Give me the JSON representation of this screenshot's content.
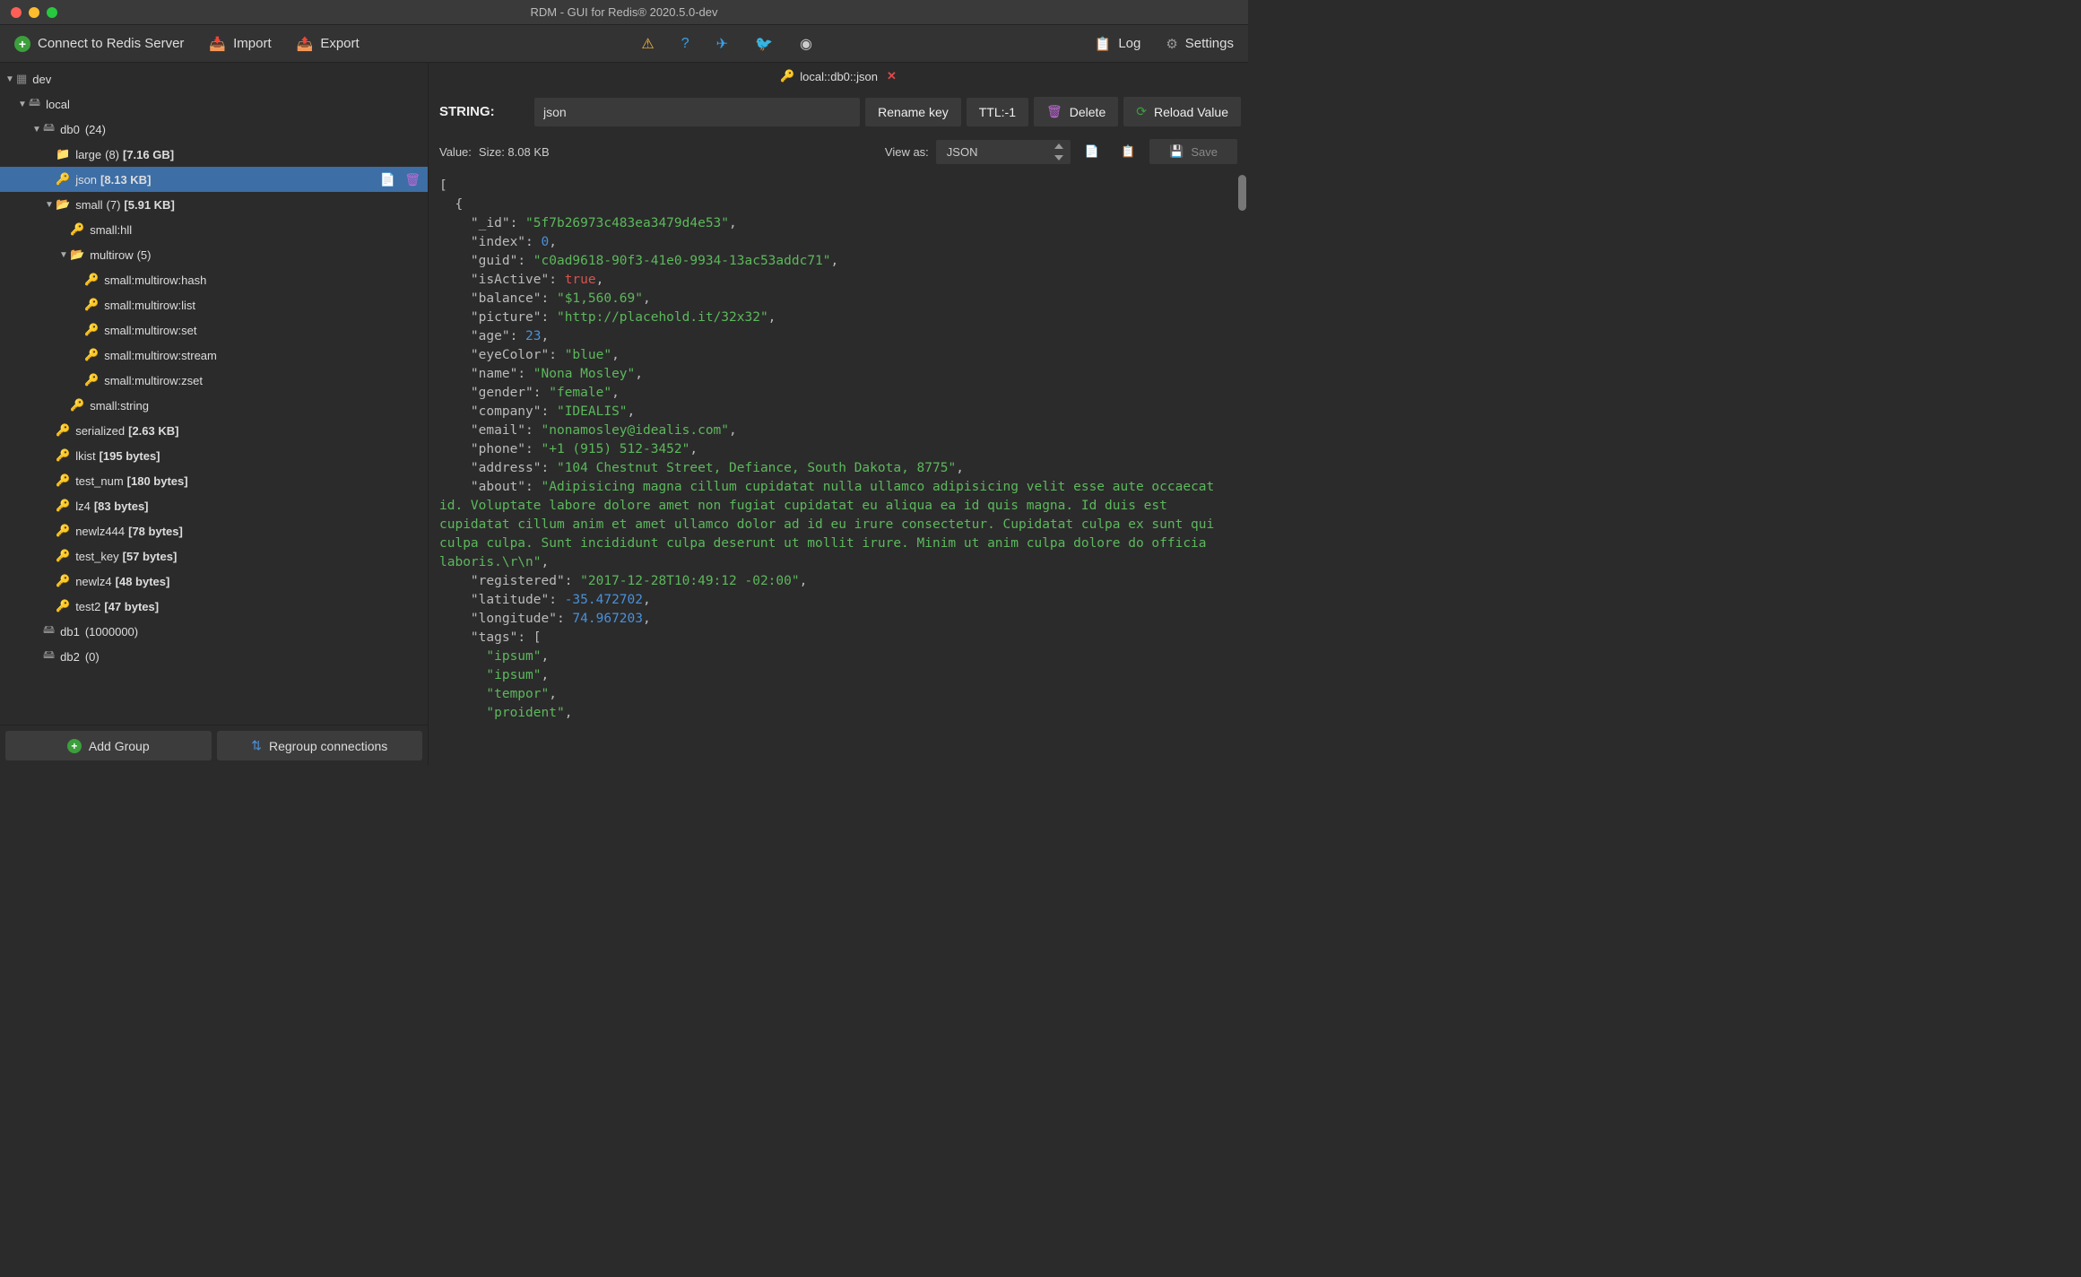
{
  "window": {
    "title": "RDM - GUI for Redis® 2020.5.0-dev"
  },
  "toolbar": {
    "connect": "Connect to Redis Server",
    "import": "Import",
    "export": "Export",
    "log": "Log",
    "settings": "Settings"
  },
  "tree": {
    "root": "dev",
    "server": "local",
    "db0": {
      "label": "db0",
      "count": "(24)"
    },
    "large": {
      "label": "large",
      "count": "(8)",
      "size": "[7.16 GB]"
    },
    "json": {
      "label": "json",
      "size": "[8.13 KB]"
    },
    "small": {
      "label": "small",
      "count": "(7)",
      "size": "[5.91 KB]"
    },
    "small_hll": "small:hll",
    "multirow": {
      "label": "multirow",
      "count": "(5)"
    },
    "mr_hash": "small:multirow:hash",
    "mr_list": "small:multirow:list",
    "mr_set": "small:multirow:set",
    "mr_stream": "small:multirow:stream",
    "mr_zset": "small:multirow:zset",
    "small_string": "small:string",
    "serialized": {
      "label": "serialized",
      "size": "[2.63 KB]"
    },
    "lkist": {
      "label": "lkist",
      "size": "[195 bytes]"
    },
    "test_num": {
      "label": "test_num",
      "size": "[180 bytes]"
    },
    "lz4": {
      "label": "lz4",
      "size": "[83 bytes]"
    },
    "newlz444": {
      "label": "newlz444",
      "size": "[78 bytes]"
    },
    "test_key": {
      "label": "test_key",
      "size": "[57 bytes]"
    },
    "newlz4": {
      "label": "newlz4",
      "size": "[48 bytes]"
    },
    "test2": {
      "label": "test2",
      "size": "[47 bytes]"
    },
    "db1": {
      "label": "db1",
      "count": "(1000000)"
    },
    "db2": {
      "label": "db2",
      "count": "(0)"
    }
  },
  "sidebar_footer": {
    "add_group": "Add Group",
    "regroup": "Regroup connections"
  },
  "tab": {
    "label": "local::db0::json"
  },
  "keyheader": {
    "type": "STRING:",
    "keyname": "json",
    "rename": "Rename key",
    "ttl": "TTL:-1",
    "delete": "Delete",
    "reload": "Reload Value"
  },
  "valuebar": {
    "value_label": "Value:",
    "size_label": "Size: 8.08 KB",
    "view_as": "View as:",
    "format": "JSON",
    "save": "Save"
  },
  "json_tokens": [
    {
      "t": "punc",
      "v": "[",
      "indent": 0
    },
    {
      "t": "punc",
      "v": "{",
      "indent": 1
    },
    {
      "t": "pair",
      "k": "\"_id\"",
      "v": "\"5f7b26973c483ea3479d4e53\"",
      "vt": "str",
      "c": ",",
      "indent": 2
    },
    {
      "t": "pair",
      "k": "\"index\"",
      "v": "0",
      "vt": "num",
      "c": ",",
      "indent": 2
    },
    {
      "t": "pair",
      "k": "\"guid\"",
      "v": "\"c0ad9618-90f3-41e0-9934-13ac53addc71\"",
      "vt": "str",
      "c": ",",
      "indent": 2
    },
    {
      "t": "pair",
      "k": "\"isActive\"",
      "v": "true",
      "vt": "bool",
      "c": ",",
      "indent": 2
    },
    {
      "t": "pair",
      "k": "\"balance\"",
      "v": "\"$1,560.69\"",
      "vt": "str",
      "c": ",",
      "indent": 2
    },
    {
      "t": "pair",
      "k": "\"picture\"",
      "v": "\"http://placehold.it/32x32\"",
      "vt": "str",
      "c": ",",
      "indent": 2
    },
    {
      "t": "pair",
      "k": "\"age\"",
      "v": "23",
      "vt": "num",
      "c": ",",
      "indent": 2
    },
    {
      "t": "pair",
      "k": "\"eyeColor\"",
      "v": "\"blue\"",
      "vt": "str",
      "c": ",",
      "indent": 2
    },
    {
      "t": "pair",
      "k": "\"name\"",
      "v": "\"Nona Mosley\"",
      "vt": "str",
      "c": ",",
      "indent": 2
    },
    {
      "t": "pair",
      "k": "\"gender\"",
      "v": "\"female\"",
      "vt": "str",
      "c": ",",
      "indent": 2
    },
    {
      "t": "pair",
      "k": "\"company\"",
      "v": "\"IDEALIS\"",
      "vt": "str",
      "c": ",",
      "indent": 2
    },
    {
      "t": "pair",
      "k": "\"email\"",
      "v": "\"nonamosley@idealis.com\"",
      "vt": "str",
      "c": ",",
      "indent": 2
    },
    {
      "t": "pair",
      "k": "\"phone\"",
      "v": "\"+1 (915) 512-3452\"",
      "vt": "str",
      "c": ",",
      "indent": 2
    },
    {
      "t": "pair",
      "k": "\"address\"",
      "v": "\"104 Chestnut Street, Defiance, South Dakota, 8775\"",
      "vt": "str",
      "c": ",",
      "indent": 2
    },
    {
      "t": "pairwrap",
      "k": "\"about\"",
      "v": "\"Adipisicing magna cillum cupidatat nulla ullamco adipisicing velit esse aute occaecat id. Voluptate labore dolore amet non fugiat cupidatat eu aliqua ea id quis magna. Id duis est cupidatat cillum anim et amet ullamco dolor ad id eu irure consectetur. Cupidatat culpa ex sunt qui culpa culpa. Sunt incididunt culpa deserunt ut mollit irure. Minim ut anim culpa dolore do officia laboris.\\r\\n\"",
      "vt": "str",
      "c": ",",
      "indent": 2
    },
    {
      "t": "pair",
      "k": "\"registered\"",
      "v": "\"2017-12-28T10:49:12 -02:00\"",
      "vt": "str",
      "c": ",",
      "indent": 2
    },
    {
      "t": "pair",
      "k": "\"latitude\"",
      "v": "-35.472702",
      "vt": "num",
      "c": ",",
      "indent": 2
    },
    {
      "t": "pair",
      "k": "\"longitude\"",
      "v": "74.967203",
      "vt": "num",
      "c": ",",
      "indent": 2
    },
    {
      "t": "key_open",
      "k": "\"tags\"",
      "v": "[",
      "indent": 2
    },
    {
      "t": "arritem",
      "v": "\"ipsum\"",
      "vt": "str",
      "c": ",",
      "indent": 3
    },
    {
      "t": "arritem",
      "v": "\"ipsum\"",
      "vt": "str",
      "c": ",",
      "indent": 3
    },
    {
      "t": "arritem",
      "v": "\"tempor\"",
      "vt": "str",
      "c": ",",
      "indent": 3
    },
    {
      "t": "arritem",
      "v": "\"proident\"",
      "vt": "str",
      "c": ",",
      "indent": 3
    }
  ]
}
